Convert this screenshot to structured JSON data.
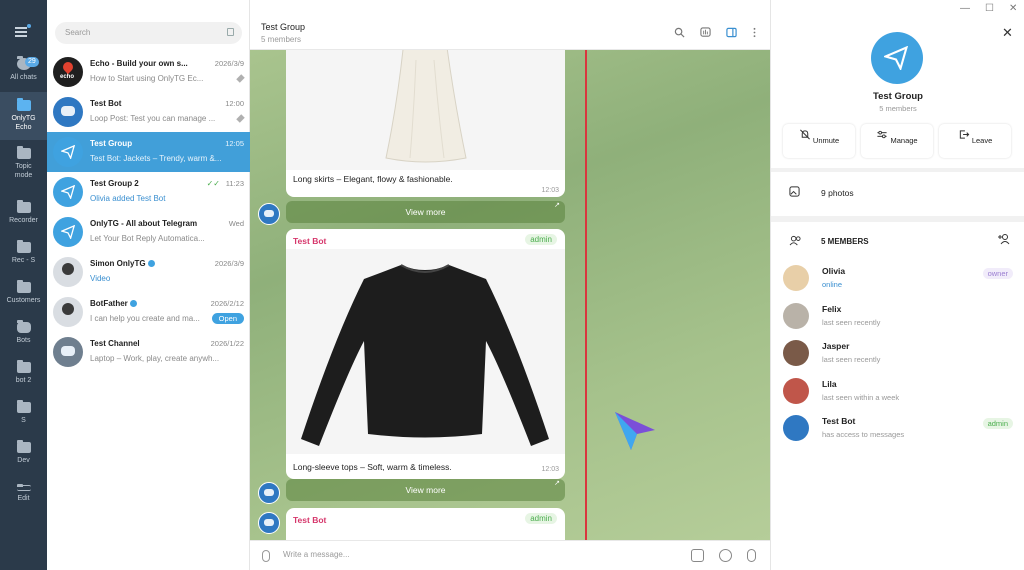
{
  "folders": [
    {
      "label": "All chats",
      "badge": "29"
    },
    {
      "label": "OnlyTG Echo"
    },
    {
      "label": "Topic mode"
    },
    {
      "label": "Recorder"
    },
    {
      "label": "Rec - S"
    },
    {
      "label": "Customers"
    },
    {
      "label": "Bots"
    },
    {
      "label": "bot 2"
    },
    {
      "label": "S"
    },
    {
      "label": "Dev"
    },
    {
      "label": "Edit"
    }
  ],
  "search": {
    "placeholder": "Search"
  },
  "chats": [
    {
      "title": "Echo - Build your own s...",
      "time": "2026/3/9",
      "preview": "How to Start using OnlyTG Ec...",
      "avatar_text": "echo"
    },
    {
      "title": "Test Bot",
      "time": "12:00",
      "preview": "Loop Post: Test you can manage ..."
    },
    {
      "title": "Test Group",
      "time": "12:05",
      "preview": "Test Bot: Jackets – Trendy, warm &..."
    },
    {
      "title": "Test Group 2",
      "time": "11:23",
      "preview": "Olivia added Test Bot"
    },
    {
      "title": "OnlyTG - All about Telegram",
      "time": "Wed",
      "preview": "Let Your Bot Reply Automatica..."
    },
    {
      "title": "Simon OnlyTG",
      "time": "2026/3/9",
      "preview": "Video"
    },
    {
      "title": "BotFather",
      "time": "2026/2/12",
      "preview": "I can help you create and ma...",
      "button": "Open"
    },
    {
      "title": "Test Channel",
      "time": "2026/1/22",
      "preview": "Laptop – Work, play, create anywh..."
    }
  ],
  "header": {
    "title": "Test Group",
    "subtitle": "5 members"
  },
  "messages": [
    {
      "caption": "Long skirts – Elegant, flowy & fashionable.",
      "time": "12:03",
      "button": "View more"
    },
    {
      "sender": "Test Bot",
      "role": "admin",
      "caption": "Long-sleeve tops – Soft, warm & timeless.",
      "time": "12:03",
      "button": "View more"
    },
    {
      "sender": "Test Bot",
      "role": "admin"
    }
  ],
  "compose": {
    "placeholder": "Write a message..."
  },
  "panel": {
    "title": "Test Group",
    "subtitle": "5 members",
    "buttons": [
      "Unmute",
      "Manage",
      "Leave"
    ],
    "photos": "9 photos",
    "members_header": "5 MEMBERS",
    "members": [
      {
        "name": "Olivia",
        "status": "online",
        "role": "owner"
      },
      {
        "name": "Felix",
        "status": "last seen recently"
      },
      {
        "name": "Jasper",
        "status": "last seen recently"
      },
      {
        "name": "Lila",
        "status": "last seen within a week"
      },
      {
        "name": "Test Bot",
        "status": "has access to messages",
        "role": "admin"
      }
    ]
  },
  "colors": {
    "accent": "#419fd9",
    "rail": "#2b3a4a",
    "sender": "#d6366b",
    "admin": "#4cae4f",
    "frame": "#d9363e"
  }
}
